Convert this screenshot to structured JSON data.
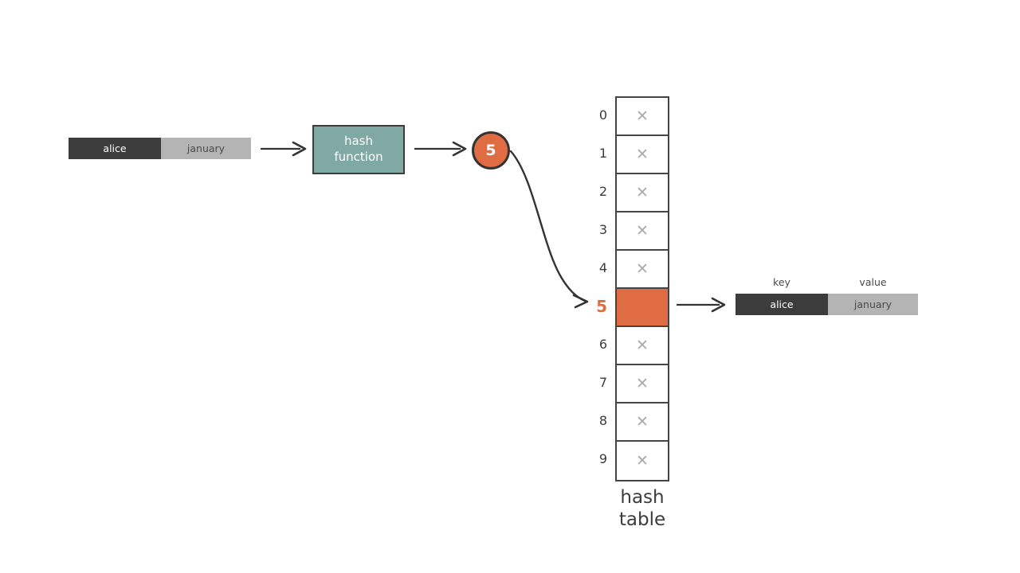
{
  "input": {
    "key": "alice",
    "value": "january"
  },
  "hash_function": {
    "line1": "hash",
    "line2": "function"
  },
  "hash_value": "5",
  "hash_table": {
    "caption_line1": "hash",
    "caption_line2": "table",
    "empty_marker": "✕",
    "indices": [
      "0",
      "1",
      "2",
      "3",
      "4",
      "5",
      "6",
      "7",
      "8",
      "9"
    ],
    "filled_index": 5,
    "cells": [
      {
        "index": "0",
        "filled": false,
        "content": "✕"
      },
      {
        "index": "1",
        "filled": false,
        "content": "✕"
      },
      {
        "index": "2",
        "filled": false,
        "content": "✕"
      },
      {
        "index": "3",
        "filled": false,
        "content": "✕"
      },
      {
        "index": "4",
        "filled": false,
        "content": "✕"
      },
      {
        "index": "5",
        "filled": true,
        "content": ""
      },
      {
        "index": "6",
        "filled": false,
        "content": "✕"
      },
      {
        "index": "7",
        "filled": false,
        "content": "✕"
      },
      {
        "index": "8",
        "filled": false,
        "content": "✕"
      },
      {
        "index": "9",
        "filled": false,
        "content": "✕"
      }
    ]
  },
  "output": {
    "key_caption": "key",
    "value_caption": "value",
    "key": "alice",
    "value": "january"
  },
  "colors": {
    "orange": "#e06c44",
    "teal": "#7fa9a2",
    "dark_gray": "#3c3c3c",
    "light_gray": "#b4b4b4",
    "stroke": "#333333",
    "empty_marker": "#aaaaaa"
  }
}
